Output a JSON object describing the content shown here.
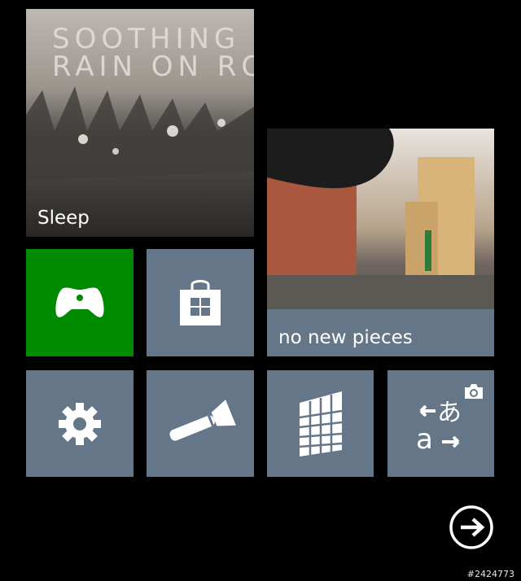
{
  "tiles": {
    "music": {
      "cover_text_line1": "SOOTHING",
      "cover_text_line2": "RAIN ON RO",
      "label": "Sleep"
    },
    "xbox": {
      "icon": "gamepad-icon",
      "color": "#008a00"
    },
    "store": {
      "icon": "store-bag-icon"
    },
    "photos": {
      "label": "no new pieces"
    },
    "settings": {
      "icon": "gear-icon"
    },
    "flashlight": {
      "icon": "flashlight-icon"
    },
    "calendar": {
      "icon": "calendar-grid-icon"
    },
    "translator": {
      "icon": "translate-icon",
      "camera_icon": "camera-icon"
    }
  },
  "tile_color": "#647687",
  "background_color": "#000000",
  "navigation": {
    "next_icon": "arrow-right-circle-icon"
  },
  "page_id": "#2424773"
}
